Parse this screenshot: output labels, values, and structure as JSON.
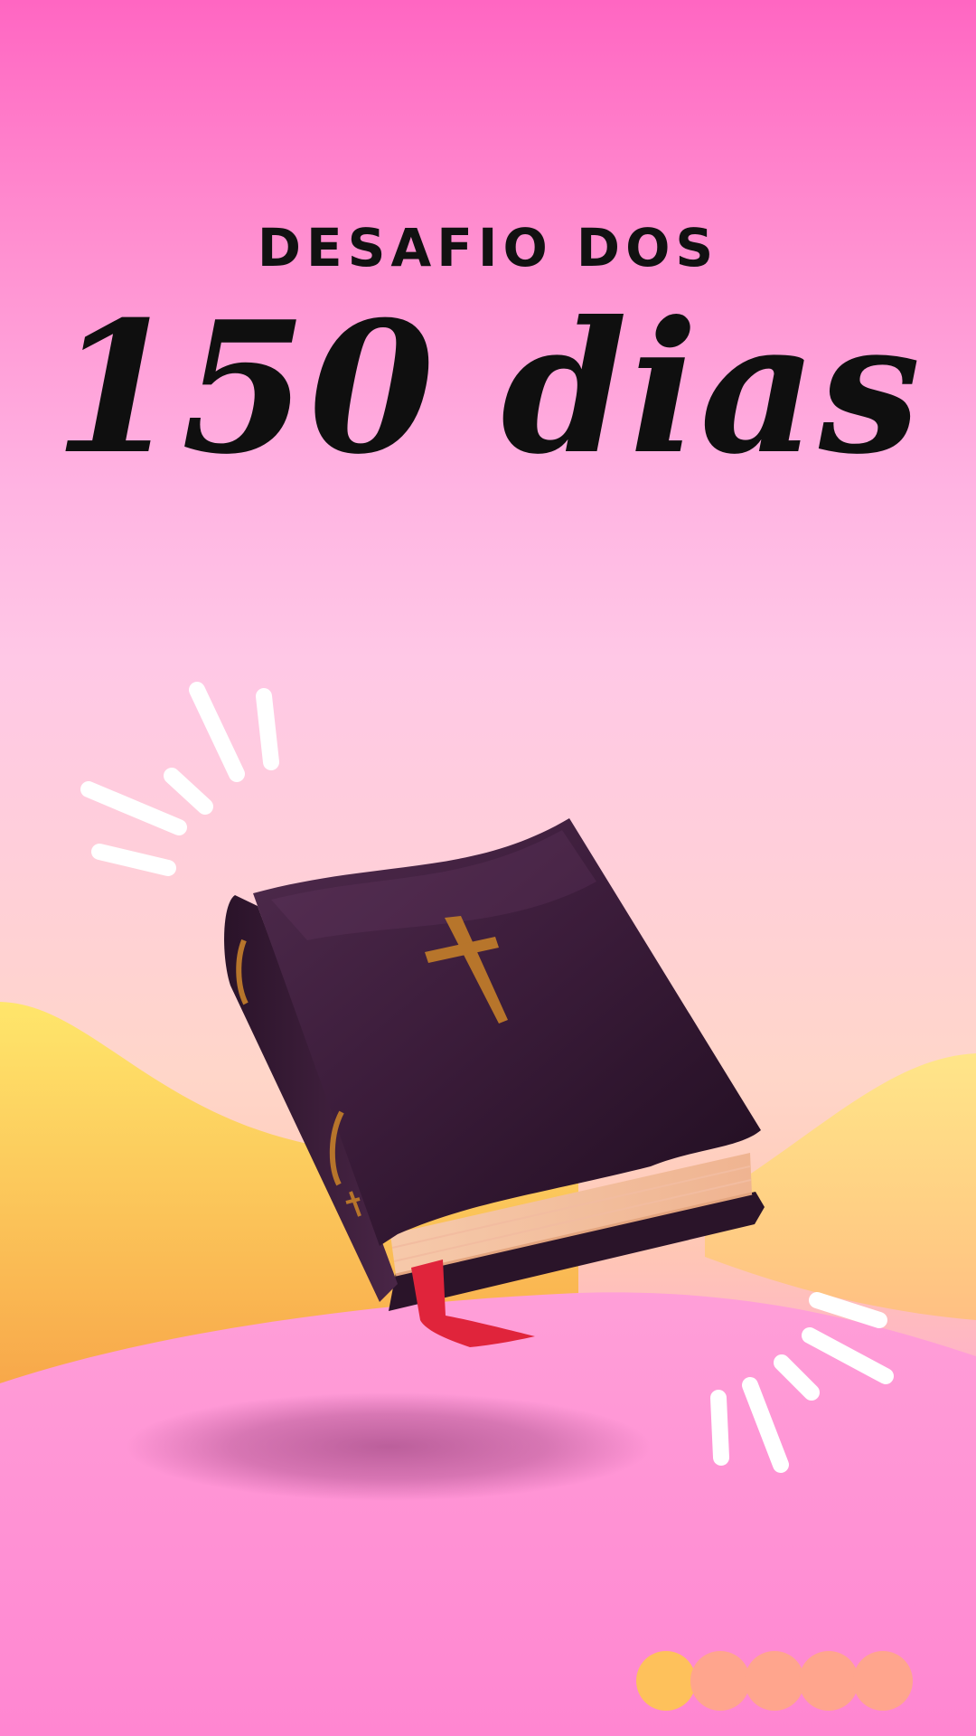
{
  "header": {
    "subtitle": "DESAFIO DOS",
    "title": "150 dias"
  },
  "illustration": {
    "icon": "bible-book-icon",
    "decor_icon": "sparkle-lines-icon",
    "book_color": "#3a1d3a",
    "cross_color": "#b7752b",
    "ribbon_color": "#e0243b",
    "hill_colors": [
      "#ffe66b",
      "#f9b94a",
      "#ff95d4"
    ]
  },
  "pagination": {
    "dot_colors": [
      "#fec15b",
      "#ffa58d",
      "#ffa58d",
      "#ffa58d",
      "#ffa58d"
    ]
  }
}
